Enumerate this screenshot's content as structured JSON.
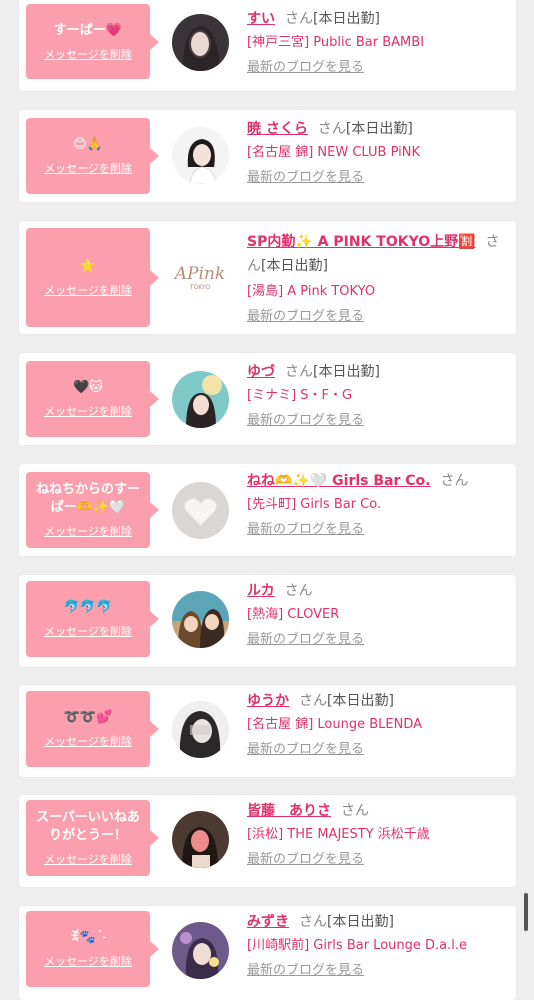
{
  "cards": [
    {
      "message": "すーぱー💗",
      "delete_label": "メッセージを削除",
      "name": "すい",
      "san": "さん",
      "today": "[本日出勤]",
      "shop": "[神戸三宮] Public Bar BAMBI",
      "blog": "最新のブログを見る",
      "avatar": "portrait-dark"
    },
    {
      "message": "😊🙏",
      "delete_label": "メッセージを削除",
      "name": "暁 さくら",
      "san": "さん",
      "today": "[本日出勤]",
      "shop": "[名古屋 錦] NEW CLUB PiNK",
      "blog": "最新のブログを見る",
      "avatar": "portrait-white"
    },
    {
      "message": "⭐",
      "delete_label": "メッセージを削除",
      "name": "SP内勤✨ A PINK TOKYO上野🈹",
      "san": "さん",
      "today": "[本日出勤]",
      "shop": "[湯島] A Pink TOKYO",
      "blog": "最新のブログを見る",
      "avatar": "apink-logo",
      "logo_text": "APink",
      "logo_sub": "TOKYO"
    },
    {
      "message": "🖤🐱",
      "delete_label": "メッセージを削除",
      "name": "ゆづ",
      "san": "さん",
      "today": "[本日出勤]",
      "shop": "[ミナミ] S・F・G",
      "blog": "最新のブログを見る",
      "avatar": "portrait-teal"
    },
    {
      "message": "ねねちからのすーぱー🫶✨🤍",
      "delete_label": "メッセージを削除",
      "name": "ねね🫶✨🤍 Girls Bar Co.",
      "san": "さん",
      "today": "",
      "shop": "[先斗町] Girls Bar Co.",
      "blog": "最新のブログを見る",
      "avatar": "heart"
    },
    {
      "message": "🐬🐬🐬",
      "delete_label": "メッセージを削除",
      "name": "ルカ",
      "san": "さん",
      "today": "",
      "shop": "[熱海] CLOVER",
      "blog": "最新のブログを見る",
      "avatar": "portrait-pair"
    },
    {
      "message": "➰➰💕",
      "delete_label": "メッセージを削除",
      "name": "ゆうか",
      "san": "さん",
      "today": "[本日出勤]",
      "shop": "[名古屋 錦] Lounge BLENDA",
      "blog": "最新のブログを見る",
      "avatar": "portrait-gray"
    },
    {
      "message": "スーパーいいねありがとうー！",
      "delete_label": "メッセージを削除",
      "name": "皆藤　ありさ",
      "san": "さん",
      "today": "",
      "shop": "[浜松] THE MAJESTY 浜松千歳",
      "blog": "最新のブログを見る",
      "avatar": "portrait-brown"
    },
    {
      "message": "ꉂ🐾ˊ˗",
      "delete_label": "メッセージを削除",
      "name": "みずき",
      "san": "さん",
      "today": "[本日出勤]",
      "shop": "[川崎駅前] Girls Bar Lounge D.a.l.e",
      "blog": "最新のブログを見る",
      "avatar": "portrait-purple"
    }
  ]
}
